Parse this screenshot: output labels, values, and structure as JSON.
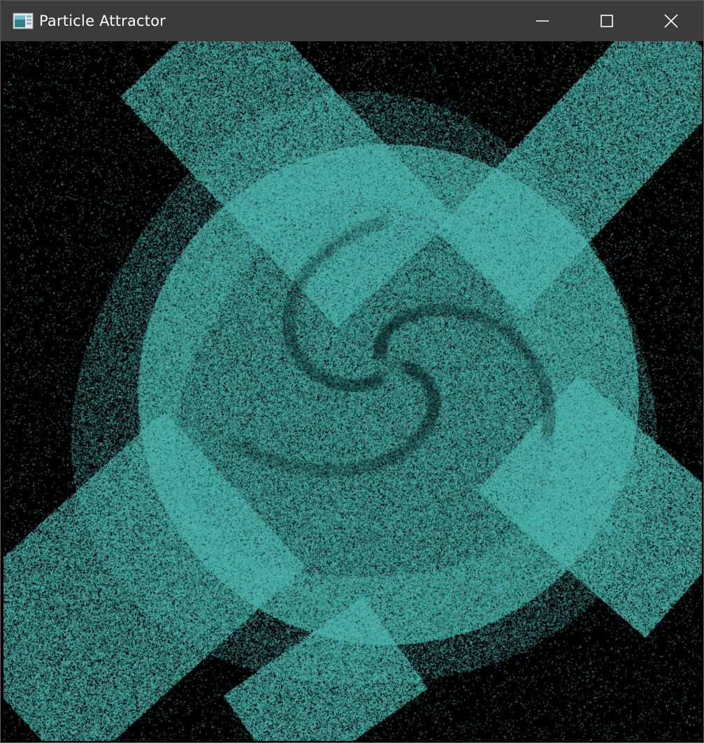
{
  "window": {
    "title": "Particle Attractor",
    "app_icon": "application-window-icon",
    "controls": {
      "minimize_icon": "minimize-icon",
      "maximize_icon": "maximize-icon",
      "close_icon": "close-icon"
    }
  },
  "canvas": {
    "background_color": "#000000",
    "particle_color": "#4fb8b0"
  }
}
